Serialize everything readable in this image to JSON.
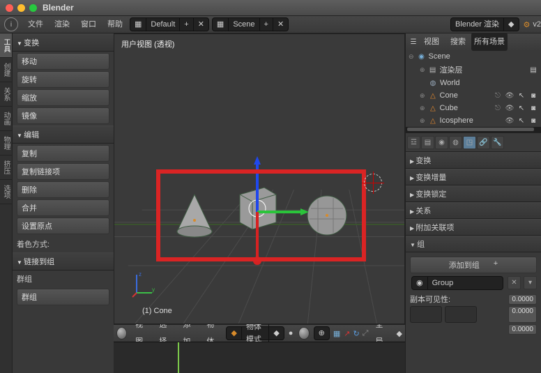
{
  "title": "Blender",
  "topmenu": [
    "文件",
    "渲染",
    "窗口",
    "帮助"
  ],
  "layout_sel": "Default",
  "scene_sel": "Scene",
  "engine_sel": "Blender 渲染",
  "version": "v2",
  "vtabs": [
    "工具",
    "创建",
    "关系",
    "动画",
    "物理",
    "挤压",
    "选项"
  ],
  "panels": {
    "transform_h": "变换",
    "transform": [
      "移动",
      "旋转",
      "缩放"
    ],
    "mirror": "镜像",
    "edit_h": "编辑",
    "edit": [
      "复制",
      "复制链接项",
      "删除",
      "合并"
    ],
    "origin": "设置原点",
    "shade": "着色方式:",
    "link_h": "链接到组",
    "group_lbl": "群组",
    "group_val": "群组"
  },
  "view": {
    "label": "用户视图 (透视)",
    "obj": "(1) Cone"
  },
  "vheader": {
    "menus": [
      "视图",
      "选择",
      "添加",
      "物体"
    ],
    "mode": "物体模式",
    "scope": "全局"
  },
  "outliner": {
    "menus": [
      "视图",
      "搜索",
      "所有场景"
    ],
    "scene": "Scene",
    "rlayer": "渲染层",
    "world": "World",
    "cone": "Cone",
    "cube": "Cube",
    "ico": "Icosphere"
  },
  "props": {
    "heads": [
      "变换",
      "变换增量",
      "变换锁定",
      "关系",
      "附加关联项"
    ],
    "group_h": "组",
    "addgroup": "添加到组",
    "group_name": "Group",
    "vis_lbl": "副本可见性:",
    "vis_val": "0.0000"
  }
}
